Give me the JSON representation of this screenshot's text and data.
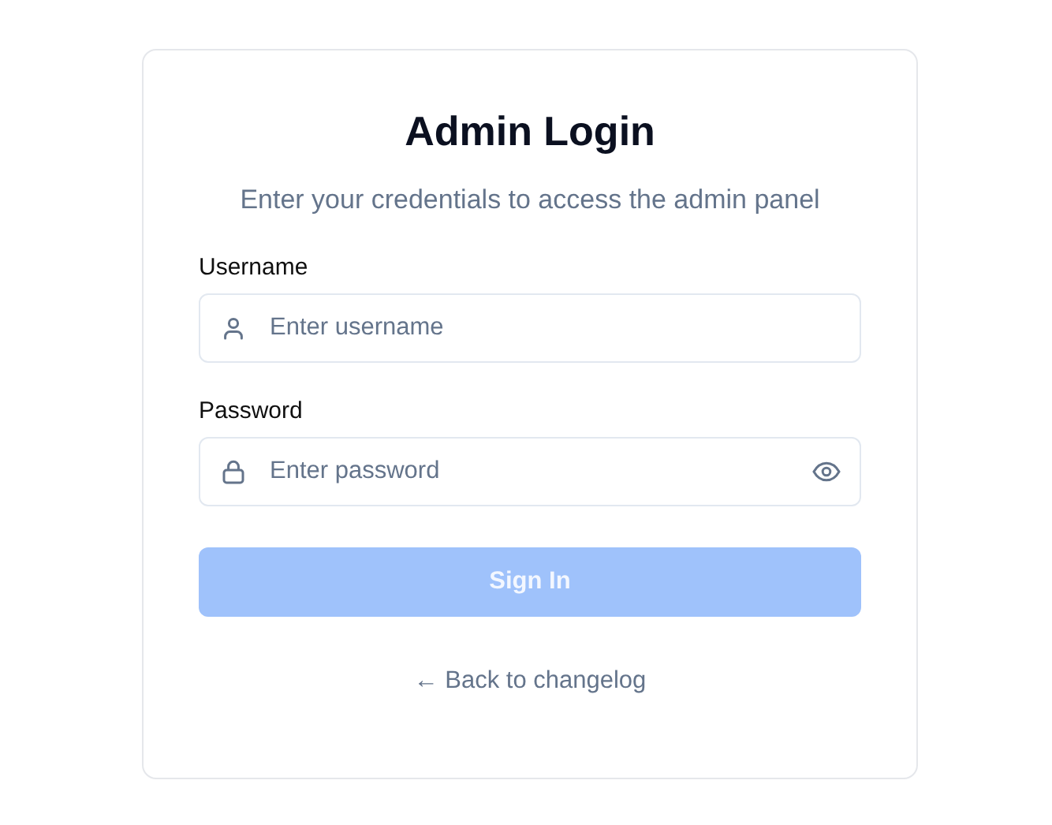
{
  "title": "Admin Login",
  "subtitle": "Enter your credentials to access the admin panel",
  "fields": [
    {
      "kind": "username",
      "label": "Username",
      "placeholder": "Enter username"
    },
    {
      "kind": "password",
      "label": "Password",
      "placeholder": "Enter password"
    }
  ],
  "submit": {
    "label": "Sign In",
    "disabled": true
  },
  "back_link": "← Back to changelog"
}
